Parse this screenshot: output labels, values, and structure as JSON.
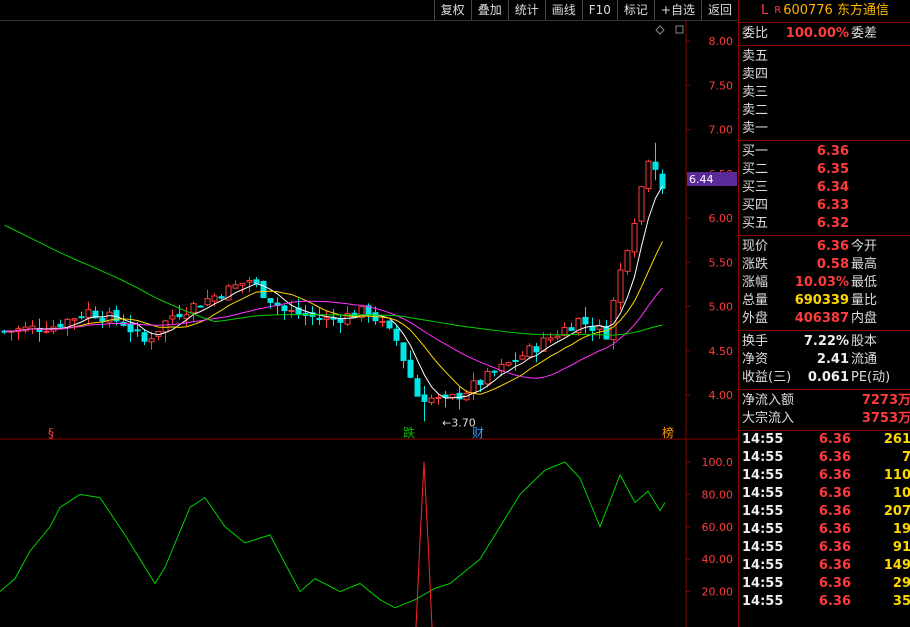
{
  "toolbar": [
    "复权",
    "叠加",
    "统计",
    "画线",
    "F10",
    "标记",
    "+自选",
    "返回"
  ],
  "stock": {
    "market": "L",
    "badge": "R",
    "code": "600776",
    "name": "东方通信"
  },
  "price_axis": [
    "8.00",
    "7.50",
    "7.00",
    "6.50",
    "6.00",
    "5.50",
    "5.00",
    "4.50",
    "4.00"
  ],
  "price_tag": "6.44",
  "low_label": "←3.70",
  "markers": [
    {
      "text": "§",
      "color": "#ff3b3b"
    },
    {
      "text": "跌",
      "color": "#00c000"
    },
    {
      "text": "财",
      "color": "#2d9bff"
    },
    {
      "text": "榜",
      "color": "#ff9900"
    }
  ],
  "indicator_axis": [
    "100.0",
    "80.00",
    "60.00",
    "40.00",
    "20.00"
  ],
  "weibi": {
    "label": "委比",
    "value": "100.00%",
    "label2": "委差"
  },
  "sell": [
    "卖五",
    "卖四",
    "卖三",
    "卖二",
    "卖一"
  ],
  "buy": [
    {
      "label": "买一",
      "price": "6.36"
    },
    {
      "label": "买二",
      "price": "6.35"
    },
    {
      "label": "买三",
      "price": "6.34"
    },
    {
      "label": "买四",
      "price": "6.33"
    },
    {
      "label": "买五",
      "price": "6.32"
    }
  ],
  "quote": [
    {
      "label": "现价",
      "value": "6.36",
      "label2": "今开",
      "color": "#ff3b3b"
    },
    {
      "label": "涨跌",
      "value": "0.58",
      "label2": "最高",
      "color": "#ff3b3b"
    },
    {
      "label": "涨幅",
      "value": "10.03%",
      "label2": "最低",
      "color": "#ff3b3b"
    },
    {
      "label": "总量",
      "value": "690339",
      "label2": "量比",
      "color": "#ffd700"
    },
    {
      "label": "外盘",
      "value": "406387",
      "label2": "内盘",
      "color": "#ff3b3b"
    }
  ],
  "fund": [
    {
      "label": "换手",
      "value": "7.22%",
      "label2": "股本",
      "color": "#eeeeee"
    },
    {
      "label": "净资",
      "value": "2.41",
      "label2": "流通",
      "color": "#eeeeee"
    },
    {
      "label": "收益(三)",
      "value": "0.061",
      "label2": "PE(动)",
      "color": "#eeeeee"
    }
  ],
  "flows": [
    {
      "label": "净流入额",
      "value": "7273万"
    },
    {
      "label": "大宗流入",
      "value": "3753万"
    }
  ],
  "ticks": [
    {
      "time": "14:55",
      "price": "6.36",
      "vol": "261"
    },
    {
      "time": "14:55",
      "price": "6.36",
      "vol": "7"
    },
    {
      "time": "14:55",
      "price": "6.36",
      "vol": "110"
    },
    {
      "time": "14:55",
      "price": "6.36",
      "vol": "10"
    },
    {
      "time": "14:55",
      "price": "6.36",
      "vol": "207"
    },
    {
      "time": "14:55",
      "price": "6.36",
      "vol": "19"
    },
    {
      "time": "14:55",
      "price": "6.36",
      "vol": "91"
    },
    {
      "time": "14:55",
      "price": "6.36",
      "vol": "149"
    },
    {
      "time": "14:55",
      "price": "6.36",
      "vol": "29"
    },
    {
      "time": "14:55",
      "price": "6.36",
      "vol": "35"
    }
  ],
  "colors": {
    "up": "#ff3b3b",
    "down": "#00e5e5",
    "ma5": "#ffffff",
    "ma10": "#ffd700",
    "ma20": "#ff33ff",
    "ma60": "#00d000",
    "ind": "#00d000",
    "spike": "#ff2222"
  }
}
